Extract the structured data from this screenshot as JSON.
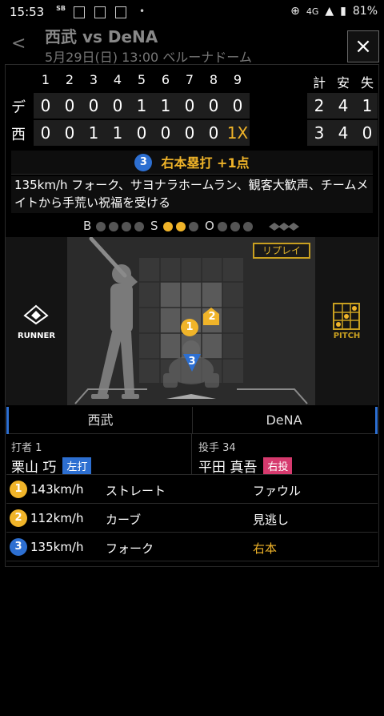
{
  "status_bar": {
    "time": "15:53",
    "network": "4G",
    "battery": "81%"
  },
  "header": {
    "title": "西武 vs DeNA",
    "subtitle": "5月29日(日) 13:00 ベルーナドーム",
    "close_label": "×",
    "back_label": "<"
  },
  "scoreboard": {
    "innings": [
      "1",
      "2",
      "3",
      "4",
      "5",
      "6",
      "7",
      "8",
      "9"
    ],
    "totals_headers": [
      "計",
      "安",
      "失"
    ],
    "teams": [
      {
        "label": "デ",
        "scores": [
          "0",
          "0",
          "0",
          "0",
          "1",
          "1",
          "0",
          "0",
          "0"
        ],
        "totals": [
          "2",
          "4",
          "1"
        ]
      },
      {
        "label": "西",
        "scores": [
          "0",
          "0",
          "1",
          "1",
          "0",
          "0",
          "0",
          "0",
          "1X"
        ],
        "totals": [
          "3",
          "4",
          "0"
        ]
      }
    ]
  },
  "play": {
    "badge": "3",
    "result": "右本塁打 +1点",
    "description": "135km/h フォーク、サヨナラホームラン、観客大歓声、チームメイトから手荒い祝福を受ける"
  },
  "count": {
    "balls_label": "B",
    "strikes_label": "S",
    "outs_label": "O",
    "balls": 0,
    "strikes": 2,
    "outs": 0
  },
  "field": {
    "replay_label": "リプレイ",
    "runner_label": "RUNNER",
    "pitch_label": "PITCH",
    "markers": [
      "1",
      "2",
      "3"
    ]
  },
  "teams": {
    "left": "西武",
    "right": "DeNA"
  },
  "batter": {
    "role": "打者 1",
    "name": "栗山 巧",
    "hand": "左打"
  },
  "pitcher": {
    "role": "投手 34",
    "name": "平田 真吾",
    "hand": "右投"
  },
  "pitches": [
    {
      "num": "1",
      "speed": "143km/h",
      "type": "ストレート",
      "result": "ファウル"
    },
    {
      "num": "2",
      "speed": "112km/h",
      "type": "カーブ",
      "result": "見逃し"
    },
    {
      "num": "3",
      "speed": "135km/h",
      "type": "フォーク",
      "result": "右本"
    }
  ],
  "colors": {
    "accent": "#f0b429",
    "blue": "#2d6fd1",
    "pink": "#d63a6e"
  }
}
